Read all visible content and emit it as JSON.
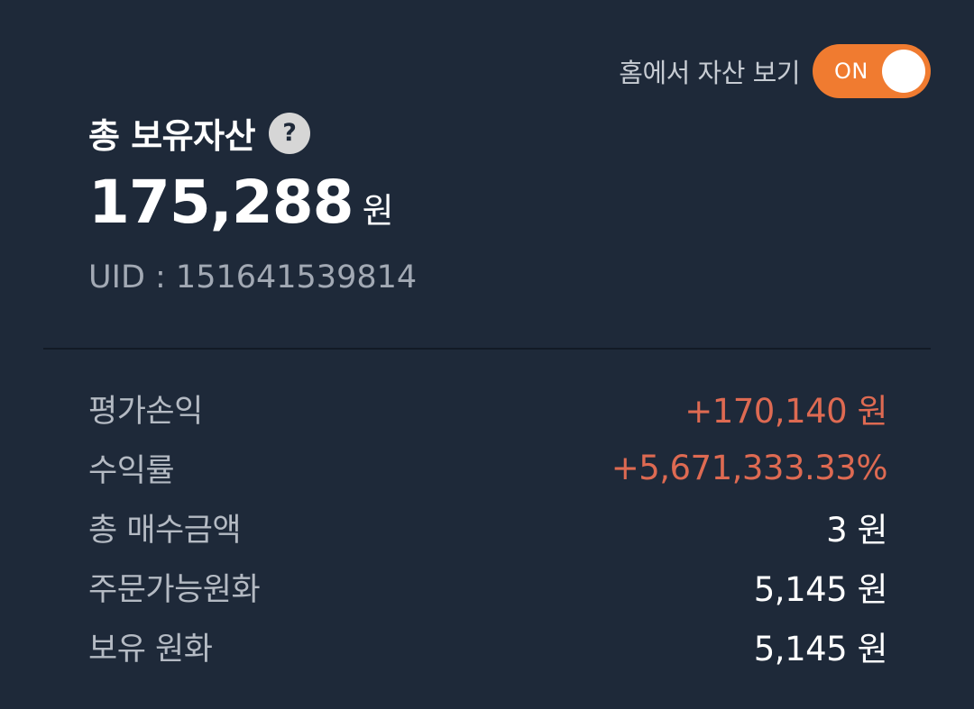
{
  "header": {
    "home_toggle_label": "홈에서 자산 보기",
    "toggle_state": "ON"
  },
  "asset": {
    "title": "총 보유자산",
    "help_icon": "?",
    "total_amount": "175,288",
    "total_unit": "원",
    "uid": "UID : 151641539814"
  },
  "stats": [
    {
      "label": "평가손익",
      "value": "+170,140 원",
      "positive": true
    },
    {
      "label": "수익률",
      "value": "+5,671,333.33%",
      "positive": true
    },
    {
      "label": "총 매수금액",
      "value": "3 원",
      "positive": false
    },
    {
      "label": "주문가능원화",
      "value": "5,145 원",
      "positive": false
    },
    {
      "label": "보유 원화",
      "value": "5,145 원",
      "positive": false
    }
  ],
  "colors": {
    "background": "#1e2939",
    "accent": "#f07b30",
    "positive": "#de6a52"
  }
}
